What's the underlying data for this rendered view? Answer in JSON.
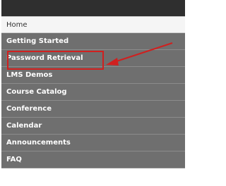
{
  "nav": {
    "items": [
      {
        "label": "Home",
        "active": true
      },
      {
        "label": "Getting Started",
        "active": false
      },
      {
        "label": "Password Retrieval",
        "active": false
      },
      {
        "label": "LMS Demos",
        "active": false
      },
      {
        "label": "Course Catalog",
        "active": false
      },
      {
        "label": "Conference",
        "active": false
      },
      {
        "label": "Calendar",
        "active": false
      },
      {
        "label": "Announcements",
        "active": false
      },
      {
        "label": "FAQ",
        "active": false
      }
    ]
  },
  "annotation": {
    "highlight_color": "#d0201f",
    "arrow_color": "#d0201f"
  }
}
